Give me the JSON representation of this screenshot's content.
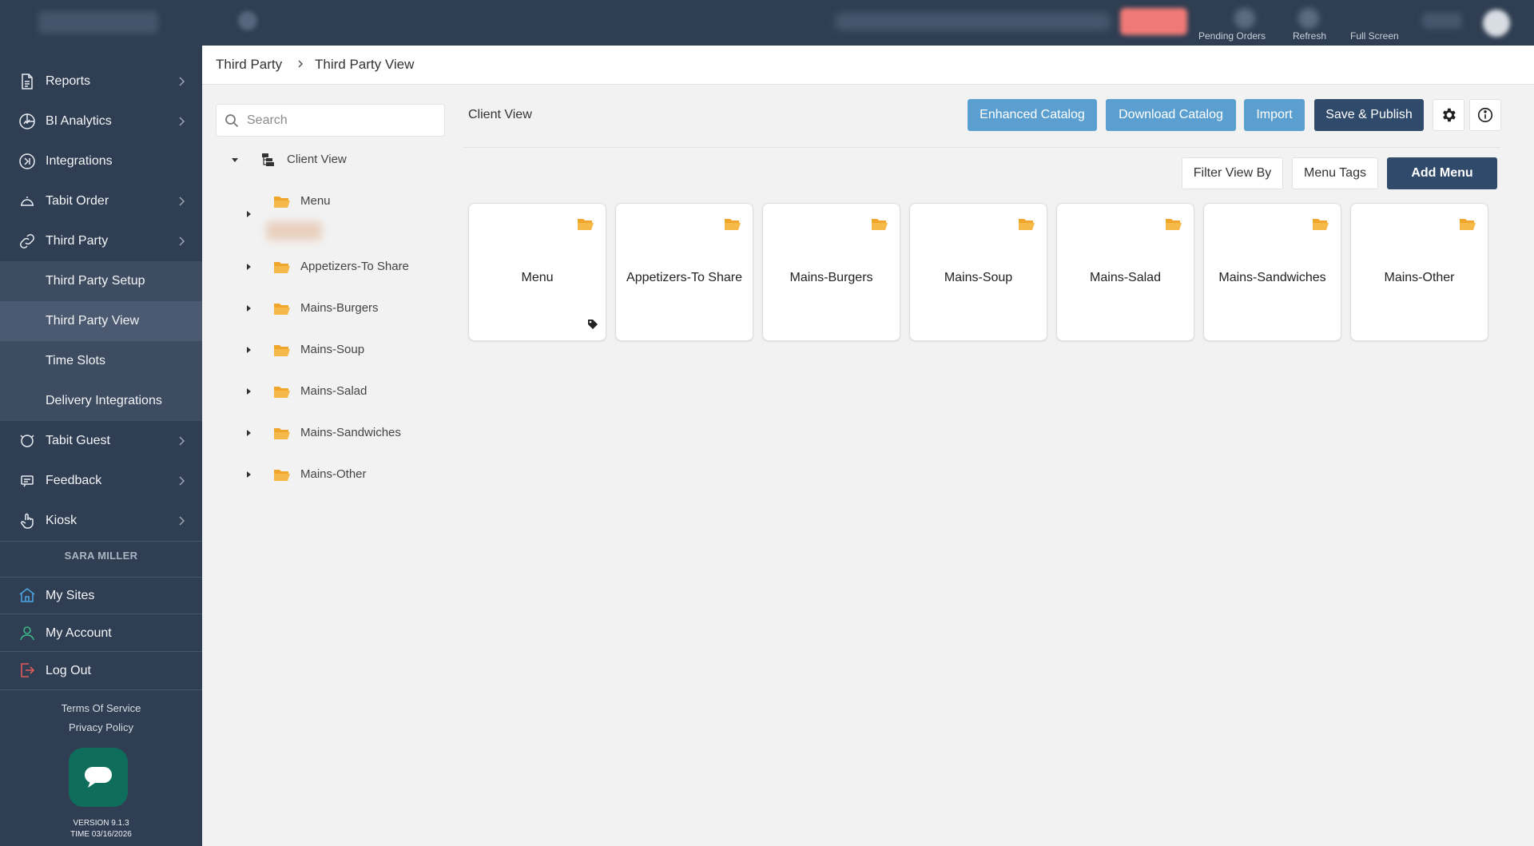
{
  "topbar": {
    "labels": [
      "Pending Orders",
      "Refresh",
      "Full Screen"
    ]
  },
  "sidebar": {
    "items": [
      {
        "label": "Reports",
        "icon": "document-icon",
        "expandable": true
      },
      {
        "label": "BI Analytics",
        "icon": "chart-icon",
        "expandable": true
      },
      {
        "label": "Integrations",
        "icon": "integrations-icon",
        "expandable": false
      },
      {
        "label": "Tabit Order",
        "icon": "order-bell-icon",
        "expandable": true
      },
      {
        "label": "Third Party",
        "icon": "link-icon",
        "expandable": true
      }
    ],
    "sub_items": [
      {
        "label": "Third Party Setup",
        "active": false
      },
      {
        "label": "Third Party View",
        "active": true
      },
      {
        "label": "Time Slots",
        "active": false
      },
      {
        "label": "Delivery Integrations",
        "active": false
      }
    ],
    "items_after": [
      {
        "label": "Tabit Guest",
        "icon": "guest-icon",
        "expandable": true
      },
      {
        "label": "Feedback",
        "icon": "feedback-icon",
        "expandable": true
      },
      {
        "label": "Kiosk",
        "icon": "hand-pointer-icon",
        "expandable": true
      }
    ],
    "user_name": "SARA MILLER",
    "account_links": [
      {
        "label": "My Sites",
        "icon": "home-icon",
        "color": "#4da3e0"
      },
      {
        "label": "My Account",
        "icon": "user-icon",
        "color": "#3bb58a"
      },
      {
        "label": "Log Out",
        "icon": "logout-icon",
        "color": "#e05a5a"
      }
    ],
    "terms": "Terms Of Service",
    "privacy": "Privacy Policy",
    "version": "VERSION 9.1.3",
    "time": "TIME 03/16/2026"
  },
  "breadcrumb": {
    "parent": "Third Party",
    "current": "Third Party View"
  },
  "tree": {
    "search_placeholder": "Search",
    "root": "Client View",
    "nodes": [
      "Menu",
      "Appetizers-To Share",
      "Mains-Burgers",
      "Mains-Soup",
      "Mains-Salad",
      "Mains-Sandwiches",
      "Mains-Other"
    ]
  },
  "content": {
    "title": "Client View",
    "buttons": {
      "enhanced_catalog": "Enhanced Catalog",
      "download_catalog": "Download Catalog",
      "import": "Import",
      "save_publish": "Save & Publish"
    },
    "filter_view_by": "Filter View By",
    "menu_tags": "Menu Tags",
    "add_menu": "Add Menu",
    "cards": [
      "Menu",
      "Appetizers-To Share",
      "Mains-Burgers",
      "Mains-Soup",
      "Mains-Salad",
      "Mains-Sandwiches",
      "Mains-Other"
    ]
  },
  "colors": {
    "sidebar_bg": "#2f3e52",
    "primary_light": "#5a9fd0",
    "primary_dark": "#2f4a6b",
    "folder": "#f0a52c"
  }
}
